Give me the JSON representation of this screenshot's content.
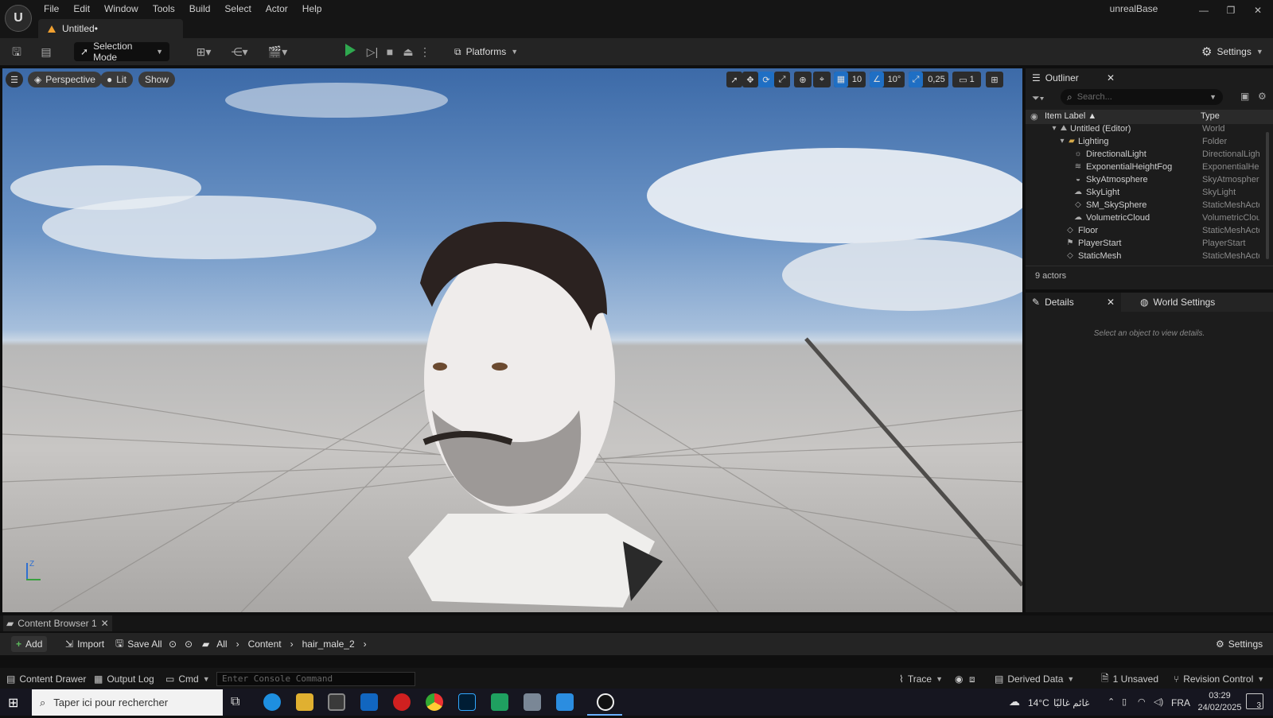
{
  "app": {
    "logo_text": "U",
    "project": "unrealBase",
    "doc_tab": "Untitled•"
  },
  "menu": [
    "File",
    "Edit",
    "Window",
    "Tools",
    "Build",
    "Select",
    "Actor",
    "Help"
  ],
  "toolbar": {
    "selection_mode": "Selection Mode",
    "platforms": "Platforms",
    "settings": "Settings"
  },
  "viewport": {
    "perspective": "Perspective",
    "lit": "Lit",
    "show": "Show",
    "grid_snap": "10",
    "rot_snap": "10°",
    "scale_snap": "0,25",
    "camera_speed": "1",
    "axis_label": "Z"
  },
  "outliner": {
    "tab": "Outliner",
    "search_placeholder": "Search...",
    "col_label": "Item Label ▲",
    "col_type": "Type",
    "rows": [
      {
        "label": "Untitled (Editor)",
        "type": "World"
      },
      {
        "label": "Lighting",
        "type": "Folder"
      },
      {
        "label": "DirectionalLight",
        "type": "DirectionalLigh"
      },
      {
        "label": "ExponentialHeightFog",
        "type": "ExponentialHei"
      },
      {
        "label": "SkyAtmosphere",
        "type": "SkyAtmospher"
      },
      {
        "label": "SkyLight",
        "type": "SkyLight"
      },
      {
        "label": "SM_SkySphere",
        "type": "StaticMeshActo"
      },
      {
        "label": "VolumetricCloud",
        "type": "VolumetricClou"
      },
      {
        "label": "Floor",
        "type": "StaticMeshActo"
      },
      {
        "label": "PlayerStart",
        "type": "PlayerStart"
      },
      {
        "label": "StaticMesh",
        "type": "StaticMeshActo"
      }
    ],
    "actor_count": "9 actors"
  },
  "details": {
    "tab": "Details",
    "world_tab": "World Settings",
    "empty_msg": "Select an object to view details."
  },
  "content_browser": {
    "tab": "Content Browser 1",
    "add": "Add",
    "import": "Import",
    "save_all": "Save All",
    "crumbs": [
      "All",
      "Content",
      "hair_male_2"
    ],
    "settings": "Settings"
  },
  "status": {
    "content_drawer": "Content Drawer",
    "output_log": "Output Log",
    "cmd": "Cmd",
    "console_placeholder": "Enter Console Command",
    "trace": "Trace",
    "derived_data": "Derived Data",
    "unsaved": "1 Unsaved",
    "revision": "Revision Control"
  },
  "taskbar": {
    "search": "Taper ici pour rechercher",
    "temp": "14°C",
    "weather_text": "غائم غالبًا",
    "lang": "FRA",
    "time": "03:29",
    "date": "24/02/2025",
    "notif": "3"
  }
}
